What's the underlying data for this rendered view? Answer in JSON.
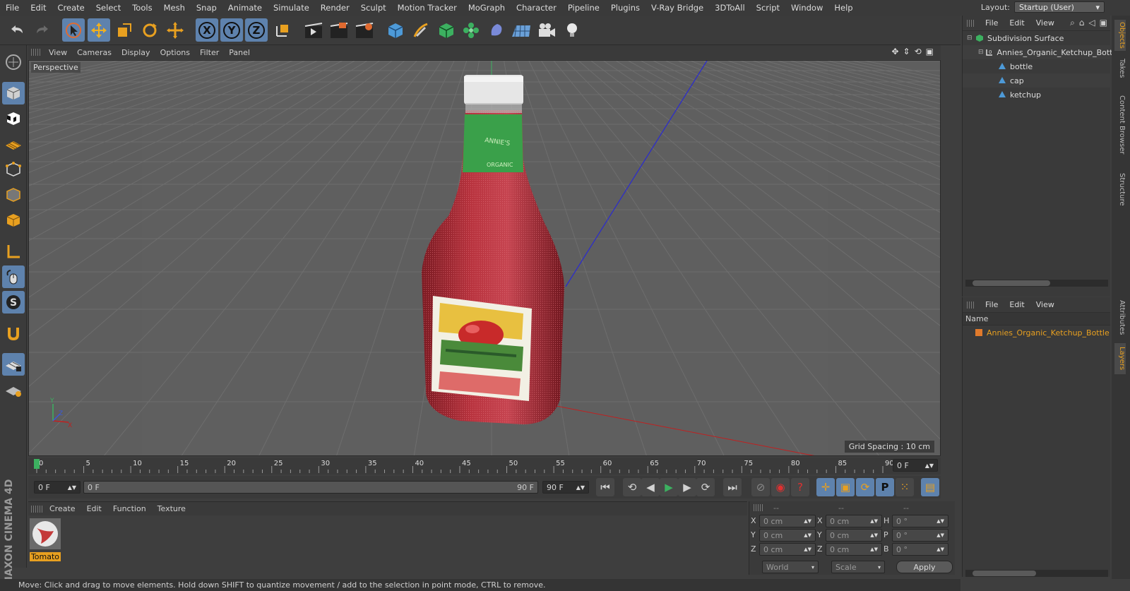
{
  "menubar": {
    "items": [
      "File",
      "Edit",
      "Create",
      "Select",
      "Tools",
      "Mesh",
      "Snap",
      "Animate",
      "Simulate",
      "Render",
      "Sculpt",
      "Motion Tracker",
      "MoGraph",
      "Character",
      "Pipeline",
      "Plugins",
      "V-Ray Bridge",
      "3DToAll",
      "Script",
      "Window",
      "Help"
    ],
    "layout_label": "Layout:",
    "layout_value": "Startup (User)"
  },
  "toolbar": {
    "icons": [
      "undo-icon",
      "redo-icon",
      "live-select-icon",
      "move-icon",
      "scale-icon",
      "rotate-icon",
      "last-tool-icon",
      "x-axis-icon",
      "y-axis-icon",
      "z-axis-icon",
      "coordinate-system-icon",
      "render-view-icon",
      "render-to-picture-viewer-icon",
      "render-settings-icon",
      "cube-icon",
      "pen-icon",
      "subdivision-icon",
      "cloner-icon",
      "deformer-icon",
      "floor-icon",
      "camera-icon",
      "light-icon"
    ],
    "x_label": "X",
    "y_label": "Y",
    "z_label": "Z"
  },
  "viewport": {
    "menu": [
      "View",
      "Cameras",
      "Display",
      "Options",
      "Filter",
      "Panel"
    ],
    "label": "Perspective",
    "grid_spacing": "Grid Spacing : 10 cm"
  },
  "timeline": {
    "ticks": [
      "0",
      "5",
      "10",
      "15",
      "20",
      "25",
      "30",
      "35",
      "40",
      "45",
      "50",
      "55",
      "60",
      "65",
      "70",
      "75",
      "80",
      "85",
      "90"
    ],
    "current_frame": "0 F"
  },
  "transport": {
    "start_frame": "0 F",
    "slider_left": "0 F",
    "slider_right": "90 F",
    "end_frame": "90 F"
  },
  "materials": {
    "menu": [
      "Create",
      "Edit",
      "Function",
      "Texture"
    ],
    "items": [
      {
        "name": "Tomato"
      }
    ]
  },
  "coords": {
    "headers": [
      "--",
      "--",
      "--"
    ],
    "rows": [
      {
        "a": "X",
        "av": "0 cm",
        "b": "X",
        "bv": "0 cm",
        "c": "H",
        "cv": "0 °"
      },
      {
        "a": "Y",
        "av": "0 cm",
        "b": "Y",
        "bv": "0 cm",
        "c": "P",
        "cv": "0 °"
      },
      {
        "a": "Z",
        "av": "0 cm",
        "b": "Z",
        "bv": "0 cm",
        "c": "B",
        "cv": "0 °"
      }
    ],
    "mode": "World",
    "scale": "Scale",
    "apply": "Apply"
  },
  "objects": {
    "menu": [
      "File",
      "Edit",
      "View"
    ],
    "tree": [
      {
        "name": "Subdivision Surface",
        "level": 0,
        "icon": "subdivision-icon"
      },
      {
        "name": "Annies_Organic_Ketchup_Bottle",
        "level": 1,
        "icon": "null-object-icon"
      },
      {
        "name": "bottle",
        "level": 2,
        "icon": "polygon-object-icon"
      },
      {
        "name": "cap",
        "level": 2,
        "icon": "polygon-object-icon"
      },
      {
        "name": "ketchup",
        "level": 2,
        "icon": "polygon-object-icon"
      }
    ]
  },
  "layers": {
    "menu": [
      "File",
      "Edit",
      "View"
    ],
    "column": "Name",
    "items": [
      {
        "name": "Annies_Organic_Ketchup_Bottle",
        "color": "#e07a2c"
      }
    ]
  },
  "sidetabs": [
    "Objects",
    "Takes",
    "Content Browser",
    "Structure",
    "Attributes",
    "Layers"
  ],
  "branding": "MAXON CINEMA 4D",
  "status": "Move: Click and drag to move elements. Hold down SHIFT to quantize movement / add to the selection in point mode, CTRL to remove.",
  "colors": {
    "accent": "#5e82ad",
    "selection": "#e07a2c",
    "viewport_bg": "#5d5d5d"
  }
}
